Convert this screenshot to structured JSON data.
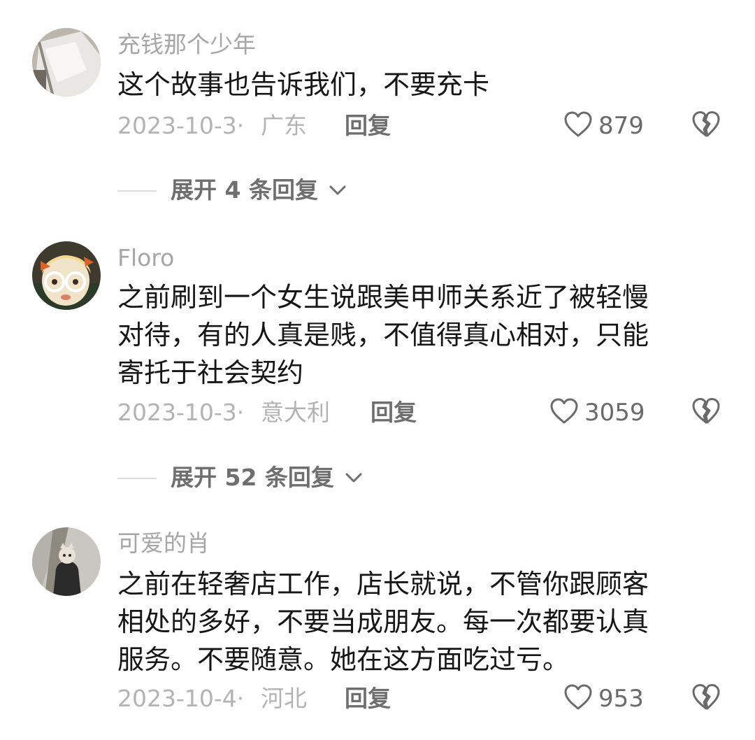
{
  "comments": [
    {
      "username": "充钱那个少年",
      "text_lines": [
        "这个故事也告诉我们，不要充卡"
      ],
      "date": "2023-10-3·",
      "location": "广东",
      "reply_label": "回复",
      "like_count": "879",
      "expand_label": "展开 4 条回复"
    },
    {
      "username": "Floro",
      "text_lines": [
        "之前刷到一个女生说跟美甲师关系近了被轻慢",
        "对待，有的人真是贱，不值得真心相对，只能",
        "寄托于社会契约"
      ],
      "date": "2023-10-3·",
      "location": "意大利",
      "reply_label": "回复",
      "like_count": "3059",
      "expand_label": "展开 52 条回复"
    },
    {
      "username": "可爱的肖",
      "text_lines": [
        "之前在轻奢店工作，店长就说，不管你跟顾客",
        "相处的多好，不要当成朋友。每一次都要认真",
        "服务。不要随意。她在这方面吃过亏。"
      ],
      "date": "2023-10-4·",
      "location": "河北",
      "reply_label": "回复",
      "like_count": "953"
    }
  ],
  "icons": {
    "like": "heart-outline-icon",
    "dislike": "broken-heart-icon",
    "expand": "chevron-down-icon"
  }
}
